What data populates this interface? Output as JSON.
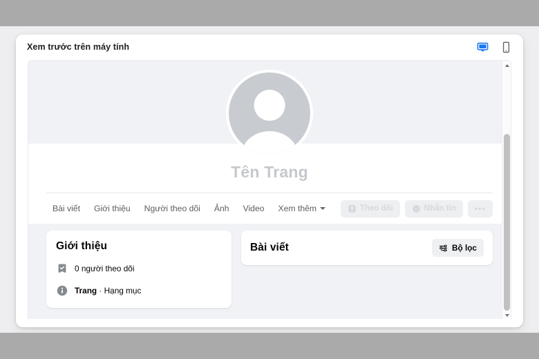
{
  "window": {
    "title": "Xem trước trên máy tính",
    "device_toggle": [
      {
        "name": "desktop",
        "icon": "monitor-icon",
        "active": true,
        "color": "#1877f2"
      },
      {
        "name": "mobile",
        "icon": "phone-icon",
        "active": false,
        "color": "#65676b"
      }
    ]
  },
  "profile": {
    "page_name": "Tên Trang",
    "avatar_icon": "default-avatar-icon",
    "tabs": [
      {
        "label": "Bài viết"
      },
      {
        "label": "Giới thiệu"
      },
      {
        "label": "Người theo dõi"
      },
      {
        "label": "Ảnh"
      },
      {
        "label": "Video"
      },
      {
        "label": "Xem thêm"
      }
    ],
    "actions": {
      "follow": {
        "label": "Theo dõi",
        "icon": "follow-plus-icon"
      },
      "message": {
        "label": "Nhắn tin",
        "icon": "messenger-icon"
      },
      "more": {
        "label": "•••"
      }
    }
  },
  "intro_card": {
    "title": "Giới thiệu",
    "rows": [
      {
        "icon": "badge-check-icon",
        "text": "0 người theo dõi"
      },
      {
        "icon": "info-circle-icon",
        "text_strong": "Trang",
        "text_rest": " · Hạng mục"
      }
    ]
  },
  "posts_card": {
    "title": "Bài viết",
    "filter": {
      "label": "Bộ lọc",
      "icon": "filter-sliders-icon"
    }
  },
  "scrollbar": {
    "up_arrow": "chevron-up-icon",
    "down_arrow": "chevron-down-icon"
  },
  "colors": {
    "accent": "#1877f2",
    "page_bg": "#f0f2f5",
    "letterbox": "#aaaaaa",
    "muted_text": "#c5c8cd"
  }
}
